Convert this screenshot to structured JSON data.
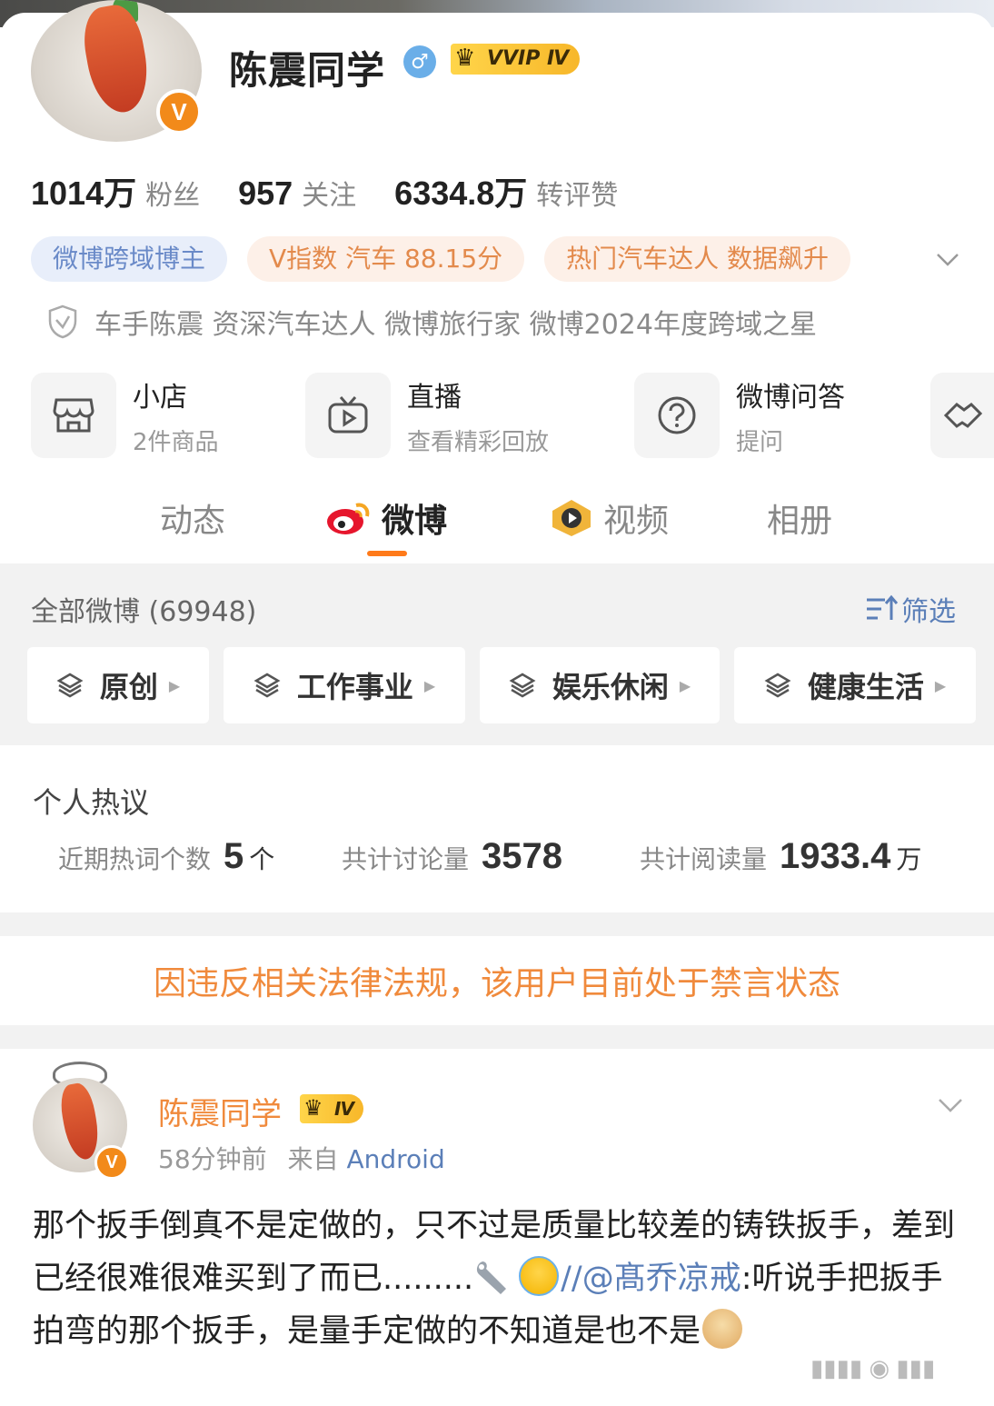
{
  "profile": {
    "name": "陈震同学",
    "vip_label": "VVIP Ⅳ",
    "verified_badge": "V",
    "gender_icon": "male-icon"
  },
  "stats": [
    {
      "value": "1014万",
      "label": "粉丝"
    },
    {
      "value": "957",
      "label": "关注"
    },
    {
      "value": "6334.8万",
      "label": "转评赞"
    }
  ],
  "tags": [
    {
      "label": "微博跨域博主",
      "style": "blue"
    },
    {
      "label": "V指数 汽车 88.15分",
      "style": "orange"
    },
    {
      "label": "热门汽车达人 数据飙升",
      "style": "orange"
    }
  ],
  "verification": "车手陈震 资深汽车达人  微博旅行家 微博2024年度跨域之星",
  "services": [
    {
      "title": "小店",
      "subtitle": "2件商品",
      "icon": "shop-icon"
    },
    {
      "title": "直播",
      "subtitle": "查看精彩回放",
      "icon": "tv-icon"
    },
    {
      "title": "微博问答",
      "subtitle": "提问",
      "icon": "question-icon"
    }
  ],
  "tabs": [
    {
      "label": "动态"
    },
    {
      "label": "微博"
    },
    {
      "label": "视频"
    },
    {
      "label": "相册"
    }
  ],
  "feed": {
    "all_label": "全部微博 (69948)",
    "filter_label": "筛选",
    "categories": [
      "原创",
      "工作事业",
      "娱乐休闲",
      "健康生活"
    ]
  },
  "hot": {
    "title": "个人热议",
    "items": [
      {
        "label": "近期热词个数",
        "value": "5",
        "unit": "个"
      },
      {
        "label": "共计讨论量",
        "value": "3578",
        "unit": ""
      },
      {
        "label": "共计阅读量",
        "value": "1933.4",
        "unit": "万"
      }
    ]
  },
  "ban_notice": "因违反相关法律法规，该用户目前处于禁言状态",
  "post": {
    "author": "陈震同学",
    "level_label": "Ⅳ",
    "time": "58分钟前",
    "from_prefix": "来自",
    "source": "Android",
    "text_part1": "那个扳手倒真不是定做的，只不过是质量比较差的铸铁扳手，差到已经很难很难买到了而已.........",
    "separator": "//",
    "mention": "@髙乔凉戒",
    "text_part2": ":听说手把扳手拍弯的那个扳手，是量手定做的不知道是也不是",
    "emojis": [
      "wrench-icon",
      "laugh-cry-emoji",
      "doge-emoji"
    ]
  },
  "colors": {
    "accent_orange": "#f08a3c",
    "link_blue": "#5b7fb8",
    "tab_underline": "#ff7a1a",
    "vip_gold": "#f7b72a"
  }
}
